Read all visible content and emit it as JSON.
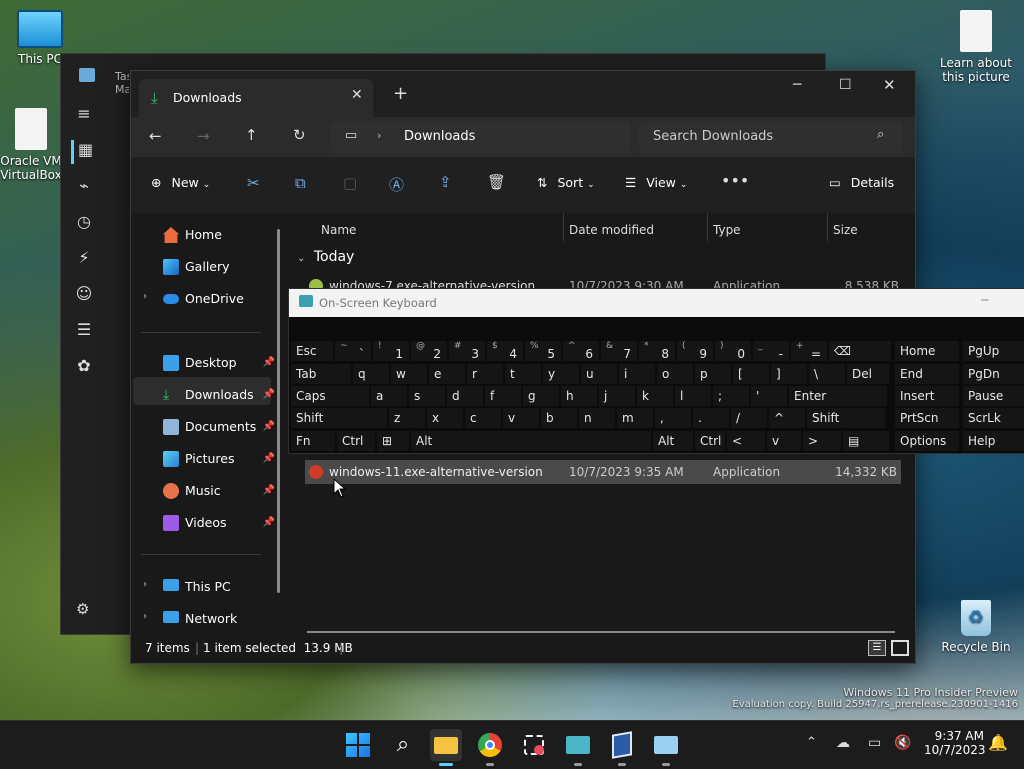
{
  "desktop": {
    "icons": [
      {
        "name": "desktop-icon-this-pc",
        "label": "This PC"
      },
      {
        "name": "desktop-icon-oracle",
        "label": "Oracle VM VirtualBox"
      },
      {
        "name": "desktop-icon-learn",
        "label": "Learn about this picture"
      },
      {
        "name": "desktop-icon-recycle-bin",
        "label": "Recycle Bin"
      }
    ],
    "watermark_line1": "Windows 11 Pro Insider Preview",
    "watermark_line2": "Evaluation copy. Build 25947.rs_prerelease.230901-1416"
  },
  "task_manager": {
    "title": "Task Manager"
  },
  "explorer": {
    "tab_title": "Downloads",
    "breadcrumb": "Downloads",
    "search_placeholder": "Search Downloads",
    "cmd": {
      "new": "New",
      "sort": "Sort",
      "view": "View",
      "details": "Details"
    },
    "nav": [
      {
        "label": "Home"
      },
      {
        "label": "Gallery"
      },
      {
        "label": "OneDrive"
      },
      {
        "label": "Desktop"
      },
      {
        "label": "Downloads"
      },
      {
        "label": "Documents"
      },
      {
        "label": "Pictures"
      },
      {
        "label": "Music"
      },
      {
        "label": "Videos"
      },
      {
        "label": "This PC"
      },
      {
        "label": "Network"
      }
    ],
    "columns": {
      "name": "Name",
      "date": "Date modified",
      "type": "Type",
      "size": "Size"
    },
    "group": "Today",
    "files": [
      {
        "name": "windows-7.exe-alternative-version",
        "date": "10/7/2023 9:30 AM",
        "type": "Application",
        "size": "8,538 KB"
      },
      {
        "name": "windows-11.exe-alternative-version",
        "date": "10/7/2023 9:35 AM",
        "type": "Application",
        "size": "14,332 KB"
      }
    ],
    "status": {
      "items": "7 items",
      "selected": "1 item selected  13.9 MB"
    }
  },
  "osk": {
    "title": "On-Screen Keyboard",
    "row1": [
      {
        "s": "",
        "m": "Esc"
      },
      {
        "s": "~",
        "m": "`"
      },
      {
        "s": "!",
        "m": "1"
      },
      {
        "s": "@",
        "m": "2"
      },
      {
        "s": "#",
        "m": "3"
      },
      {
        "s": "$",
        "m": "4"
      },
      {
        "s": "%",
        "m": "5"
      },
      {
        "s": "^",
        "m": "6"
      },
      {
        "s": "&",
        "m": "7"
      },
      {
        "s": "*",
        "m": "8"
      },
      {
        "s": "(",
        "m": "9"
      },
      {
        "s": ")",
        "m": "0"
      },
      {
        "s": "_",
        "m": "-"
      },
      {
        "s": "+",
        "m": "="
      },
      {
        "s": "",
        "m": "⌫"
      }
    ],
    "row2": [
      "Tab",
      "q",
      "w",
      "e",
      "r",
      "t",
      "y",
      "u",
      "i",
      "o",
      "p",
      "[",
      "]",
      "\\",
      "Del"
    ],
    "row3": [
      "Caps",
      "a",
      "s",
      "d",
      "f",
      "g",
      "h",
      "j",
      "k",
      "l",
      ";",
      "'",
      "Enter"
    ],
    "row4": [
      "Shift",
      "z",
      "x",
      "c",
      "v",
      "b",
      "n",
      "m",
      ",",
      ".",
      "/",
      "^",
      "Shift"
    ],
    "row5": [
      "Fn",
      "Ctrl",
      "⊞",
      "Alt",
      "Alt",
      "Ctrl",
      "<",
      "v",
      ">",
      "▤"
    ],
    "right": [
      "Home",
      "PgUp",
      "End",
      "PgDn",
      "Insert",
      "Pause",
      "PrtScn",
      "ScrLk",
      "Options",
      "Help"
    ]
  },
  "taskbar": {
    "time": "9:37 AM",
    "date": "10/7/2023"
  }
}
